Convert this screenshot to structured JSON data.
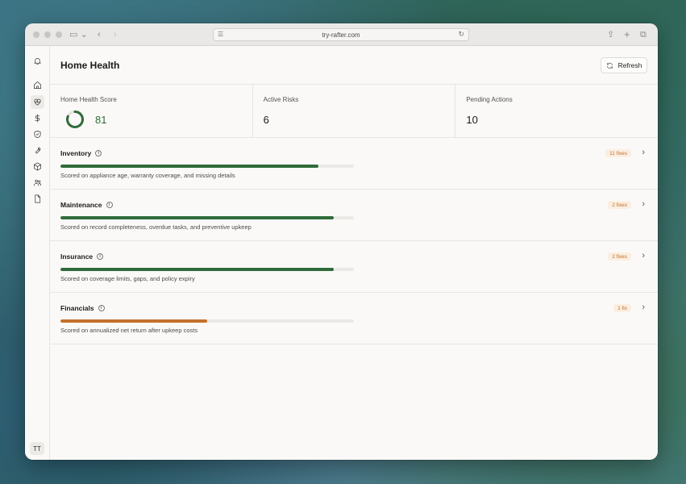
{
  "browser": {
    "url": "try-rafter.com"
  },
  "page": {
    "title": "Home Health",
    "refresh_label": "Refresh"
  },
  "stats": [
    {
      "label": "Home Health Score",
      "value": "81"
    },
    {
      "label": "Active Risks",
      "value": "6"
    },
    {
      "label": "Pending Actions",
      "value": "10"
    }
  ],
  "score_fraction": 0.81,
  "categories": [
    {
      "name": "Inventory",
      "badge": "11 fixes",
      "fill": 0.88,
      "color": "#2f6b3a",
      "desc": "Scored on appliance age, warranty coverage, and missing details"
    },
    {
      "name": "Maintenance",
      "badge": "2 fixes",
      "fill": 0.93,
      "color": "#2f6b3a",
      "desc": "Scored on record completeness, overdue tasks, and preventive upkeep"
    },
    {
      "name": "Insurance",
      "badge": "2 fixes",
      "fill": 0.93,
      "color": "#2f6b3a",
      "desc": "Scored on coverage limits, gaps, and policy expiry"
    },
    {
      "name": "Financials",
      "badge": "1 fix",
      "fill": 0.5,
      "color": "#c4702a",
      "desc": "Scored on annualized net return after upkeep costs"
    }
  ],
  "sidebar": {
    "icons": [
      "bell-icon",
      "home-icon",
      "heart-pulse-icon",
      "dollar-icon",
      "shield-icon",
      "wrench-icon",
      "box-icon",
      "users-icon",
      "document-icon"
    ],
    "active": "heart-pulse-icon",
    "avatar": "TT"
  },
  "colors": {
    "accent_green": "#2f6b3a",
    "warning_orange": "#c4702a",
    "badge_bg": "#fbeee1"
  }
}
